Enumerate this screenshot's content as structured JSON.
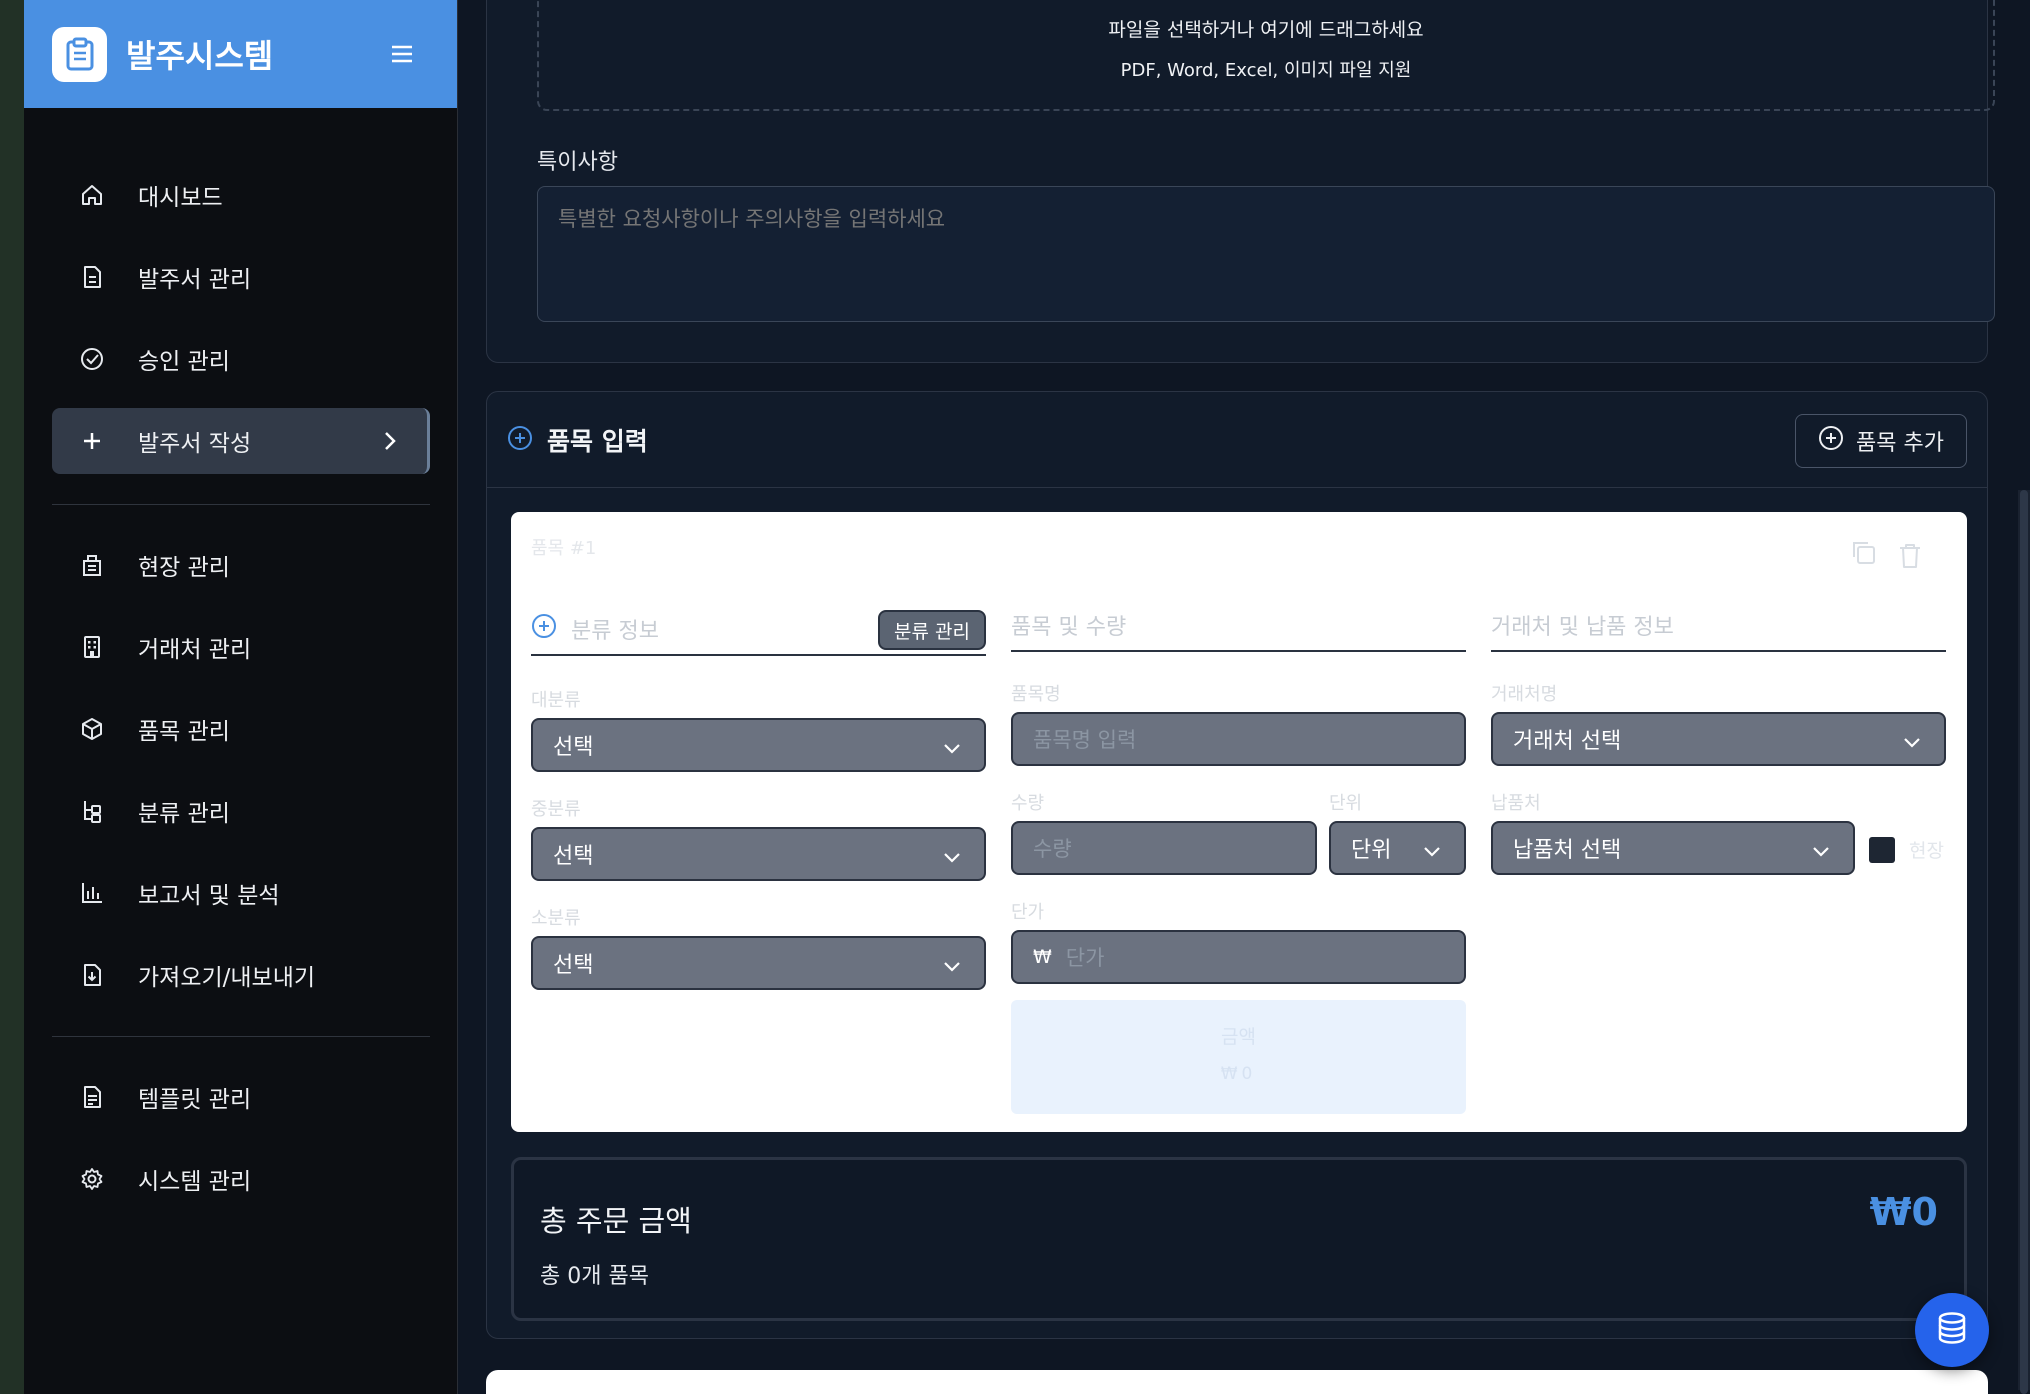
{
  "app": {
    "title": "발주시스템"
  },
  "sidebar": {
    "items": [
      {
        "label": "대시보드",
        "icon": "home-icon"
      },
      {
        "label": "발주서 관리",
        "icon": "document-icon"
      },
      {
        "label": "승인 관리",
        "icon": "check-circle-icon"
      },
      {
        "label": "발주서 작성",
        "icon": "plus-icon",
        "active": true
      },
      {
        "label": "현장 관리",
        "icon": "building-icon"
      },
      {
        "label": "거래처 관리",
        "icon": "office-building-icon"
      },
      {
        "label": "품목 관리",
        "icon": "cube-icon"
      },
      {
        "label": "분류 관리",
        "icon": "hierarchy-icon"
      },
      {
        "label": "보고서 및 분석",
        "icon": "bar-chart-icon"
      },
      {
        "label": "가져오기/내보내기",
        "icon": "file-download-icon"
      },
      {
        "label": "템플릿 관리",
        "icon": "template-icon"
      },
      {
        "label": "시스템 관리",
        "icon": "gear-icon"
      }
    ]
  },
  "upload": {
    "text": "파일을 선택하거나 여기에 드래그하세요",
    "formats": "PDF, Word, Excel, 이미지 파일 지원"
  },
  "notes": {
    "label": "특이사항",
    "placeholder": "특별한 요청사항이나 주의사항을 입력하세요"
  },
  "items_section": {
    "title": "품목 입력",
    "add_label": "품목 추가",
    "item": {
      "number": "품목 #1",
      "category": {
        "header": "분류 정보",
        "manage_label": "분류 관리",
        "major_label": "대분류",
        "major_value": "선택",
        "middle_label": "중분류",
        "middle_value": "선택",
        "minor_label": "소분류",
        "minor_value": "선택"
      },
      "product": {
        "header": "품목 및 수량",
        "name_label": "품목명",
        "name_placeholder": "품목명 입력",
        "qty_label": "수량",
        "qty_placeholder": "수량",
        "unit_label": "단위",
        "unit_value": "단위",
        "price_label": "단가",
        "currency": "₩",
        "price_placeholder": "단가",
        "amount_label": "금액",
        "amount_value": "₩0"
      },
      "supplier": {
        "header": "거래처 및 납품 정보",
        "vendor_label": "거래처명",
        "vendor_value": "거래처 선택",
        "delivery_label": "납품처",
        "delivery_value": "납품처 선택",
        "site_label": "현장"
      }
    }
  },
  "total": {
    "title": "총 주문 금액",
    "count": "총 0개 품목",
    "value": "₩0"
  },
  "colors": {
    "accent": "#4a90e2",
    "fab": "#2563eb",
    "sidebar_bg": "#0c0e12",
    "main_bg": "#0e1623"
  }
}
